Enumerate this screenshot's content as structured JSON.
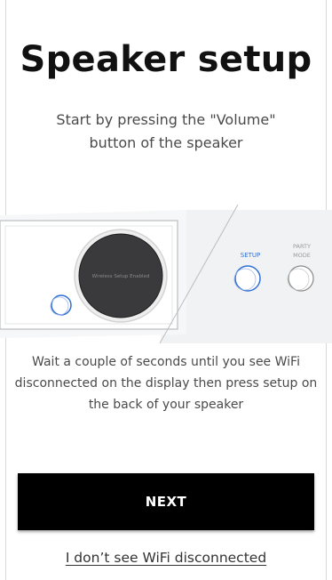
{
  "page": {
    "title": "Speaker setup",
    "subtitle": "Start by pressing the \"Volume\" button of the speaker",
    "instructions": "Wait a couple of seconds until you see WiFi disconnected on the display then press setup on the back of your speaker",
    "next_button_label": "NEXT",
    "help_link_label": "I don’t see WiFi disconnected"
  },
  "illustration": {
    "display_text": "Wireless Setup Enabled",
    "setup_label": "SETUP",
    "party_mode_label_line1": "PARTY",
    "party_mode_label_line2": "MODE",
    "front_panel_icon": "speaker-front-panel",
    "back_panel_icon": "speaker-back-panel"
  },
  "colors": {
    "accent_blue": "#2f6fd6",
    "button_background": "#000000",
    "button_text": "#ffffff"
  }
}
